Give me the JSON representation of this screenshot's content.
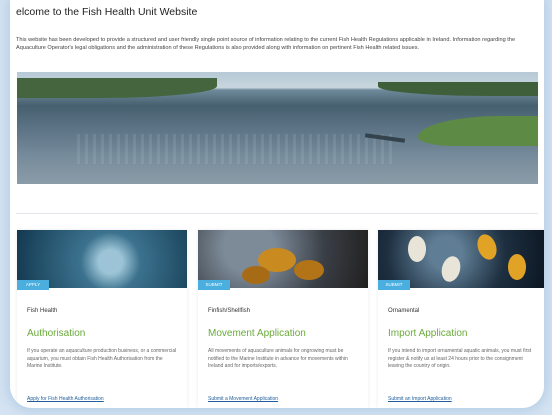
{
  "page": {
    "title": "elcome to the Fish Health Unit Website",
    "intro": "This website has been developed to provide a structured and user friendly single point source of information relating to the current Fish Health Regulations applicable in Ireland. Information regarding the Aquaculture Operator's legal obligations and the administration of these Regulations is also provided along with information on pertinent Fish Health related issues."
  },
  "cards": [
    {
      "tag": "APPLY",
      "category": "Fish Health",
      "heading": "Authorisation",
      "text": "If you operate an aquaculture production business, or a commercial aquarium, you must obtain Fish Health Authorisation from the Marine Institute.",
      "link": "Apply for Fish Health Authorisation"
    },
    {
      "tag": "SUBMIT",
      "category": "Finfish/Shellfish",
      "heading": "Movement Application",
      "text": "All movements of aquaculture animals for ongrowing must be notified to the Marine Institute in advance for movements within Ireland and for imports/exports.",
      "link": "Submit a Movement Application"
    },
    {
      "tag": "SUBMIT",
      "category": "Ornamental",
      "heading": "Import Application",
      "text": "If you intend to import ornamental aquatic animals, you must first register & notify us at least 24 hours prior to the consignment leaving the country of origin.",
      "link": "Submit an Import Application"
    }
  ],
  "colors": {
    "accent": "#6aaa3a",
    "tag": "#4aaede",
    "link": "#1f5e9a"
  }
}
